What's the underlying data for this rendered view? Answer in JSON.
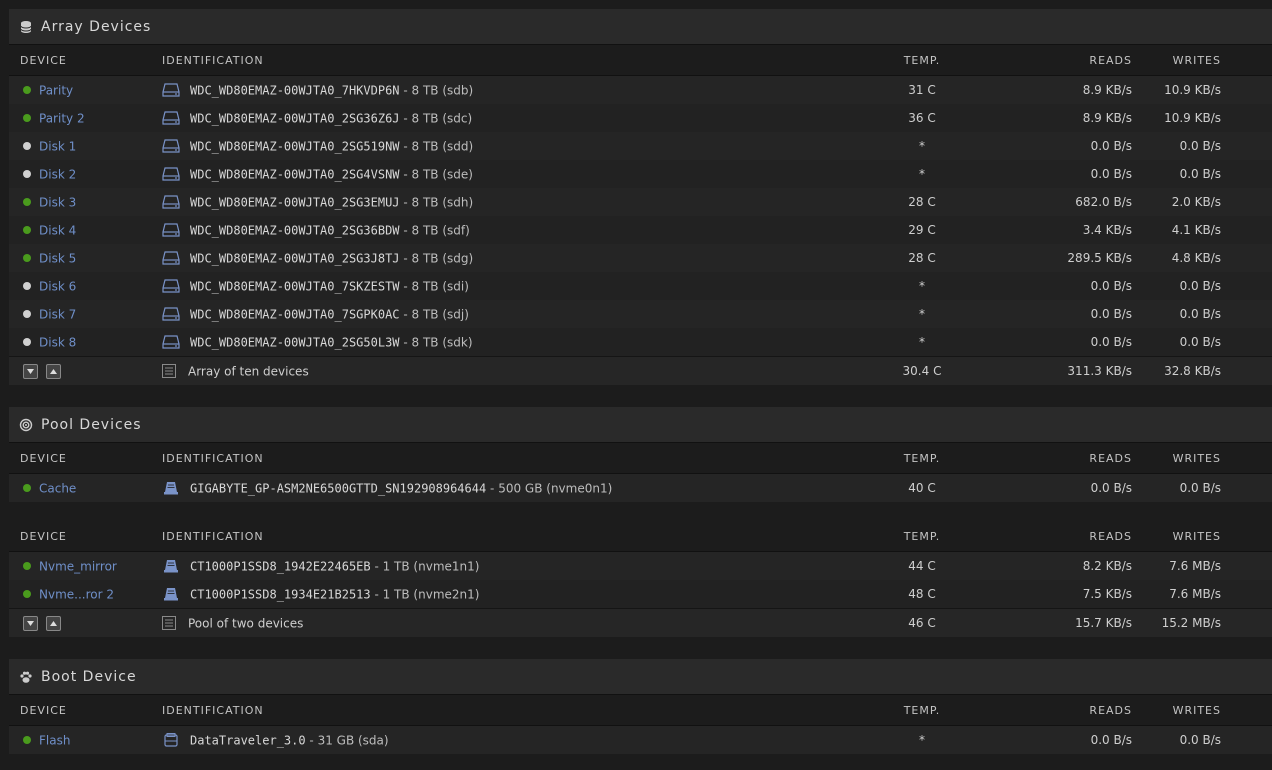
{
  "array": {
    "title": "Array Devices",
    "headers": {
      "device": "DEVICE",
      "ident": "IDENTIFICATION",
      "temp": "TEMP.",
      "reads": "READS",
      "writes": "WRITES"
    },
    "rows": [
      {
        "status": "green",
        "name": "Parity",
        "model": "WDC_WD80EMAZ-00WJTA0_7HKVDP6N",
        "size": "- 8 TB (sdb)",
        "temp": "31 C",
        "reads": "8.9 KB/s",
        "writes": "10.9 KB/s"
      },
      {
        "status": "green",
        "name": "Parity 2",
        "model": "WDC_WD80EMAZ-00WJTA0_2SG36Z6J",
        "size": "- 8 TB (sdc)",
        "temp": "36 C",
        "reads": "8.9 KB/s",
        "writes": "10.9 KB/s"
      },
      {
        "status": "grey",
        "name": "Disk 1",
        "model": "WDC_WD80EMAZ-00WJTA0_2SG519NW",
        "size": "- 8 TB (sdd)",
        "temp": "*",
        "reads": "0.0 B/s",
        "writes": "0.0 B/s"
      },
      {
        "status": "grey",
        "name": "Disk 2",
        "model": "WDC_WD80EMAZ-00WJTA0_2SG4VSNW",
        "size": "- 8 TB (sde)",
        "temp": "*",
        "reads": "0.0 B/s",
        "writes": "0.0 B/s"
      },
      {
        "status": "green",
        "name": "Disk 3",
        "model": "WDC_WD80EMAZ-00WJTA0_2SG3EMUJ",
        "size": "- 8 TB (sdh)",
        "temp": "28 C",
        "reads": "682.0 B/s",
        "writes": "2.0 KB/s"
      },
      {
        "status": "green",
        "name": "Disk 4",
        "model": "WDC_WD80EMAZ-00WJTA0_2SG36BDW",
        "size": "- 8 TB (sdf)",
        "temp": "29 C",
        "reads": "3.4 KB/s",
        "writes": "4.1 KB/s"
      },
      {
        "status": "green",
        "name": "Disk 5",
        "model": "WDC_WD80EMAZ-00WJTA0_2SG3J8TJ",
        "size": "- 8 TB (sdg)",
        "temp": "28 C",
        "reads": "289.5 KB/s",
        "writes": "4.8 KB/s"
      },
      {
        "status": "grey",
        "name": "Disk 6",
        "model": "WDC_WD80EMAZ-00WJTA0_7SKZESTW",
        "size": "- 8 TB (sdi)",
        "temp": "*",
        "reads": "0.0 B/s",
        "writes": "0.0 B/s"
      },
      {
        "status": "grey",
        "name": "Disk 7",
        "model": "WDC_WD80EMAZ-00WJTA0_7SGPK0AC",
        "size": "- 8 TB (sdj)",
        "temp": "*",
        "reads": "0.0 B/s",
        "writes": "0.0 B/s"
      },
      {
        "status": "grey",
        "name": "Disk 8",
        "model": "WDC_WD80EMAZ-00WJTA0_2SG50L3W",
        "size": "- 8 TB (sdk)",
        "temp": "*",
        "reads": "0.0 B/s",
        "writes": "0.0 B/s"
      }
    ],
    "summary": {
      "label": "Array of ten devices",
      "temp": "30.4 C",
      "reads": "311.3 KB/s",
      "writes": "32.8 KB/s"
    }
  },
  "pool": {
    "title": "Pool Devices",
    "headers": {
      "device": "DEVICE",
      "ident": "IDENTIFICATION",
      "temp": "TEMP.",
      "reads": "READS",
      "writes": "WRITES"
    },
    "cache": {
      "status": "green",
      "name": "Cache",
      "model": "GIGABYTE_GP-ASM2NE6500GTTD_SN192908964644",
      "size": "- 500 GB (nvme0n1)",
      "temp": "40 C",
      "reads": "0.0 B/s",
      "writes": "0.0 B/s"
    },
    "mirror_rows": [
      {
        "status": "green",
        "name": "Nvme_mirror",
        "model": "CT1000P1SSD8_1942E22465EB",
        "size": "- 1 TB (nvme1n1)",
        "temp": "44 C",
        "reads": "8.2 KB/s",
        "writes": "7.6 MB/s"
      },
      {
        "status": "green",
        "name": "Nvme...ror 2",
        "model": "CT1000P1SSD8_1934E21B2513",
        "size": "- 1 TB (nvme2n1)",
        "temp": "48 C",
        "reads": "7.5 KB/s",
        "writes": "7.6 MB/s"
      }
    ],
    "summary": {
      "label": "Pool of two devices",
      "temp": "46 C",
      "reads": "15.7 KB/s",
      "writes": "15.2 MB/s"
    }
  },
  "boot": {
    "title": "Boot Device",
    "headers": {
      "device": "DEVICE",
      "ident": "IDENTIFICATION",
      "temp": "TEMP.",
      "reads": "READS",
      "writes": "WRITES"
    },
    "row": {
      "status": "green",
      "name": "Flash",
      "model": "DataTraveler_3.0",
      "size": "- 31 GB (sda)",
      "temp": "*",
      "reads": "0.0 B/s",
      "writes": "0.0 B/s"
    }
  },
  "colors": {
    "green": "#4a9b1d",
    "grey": "#d0d0d0",
    "link": "#6f8fc8"
  }
}
